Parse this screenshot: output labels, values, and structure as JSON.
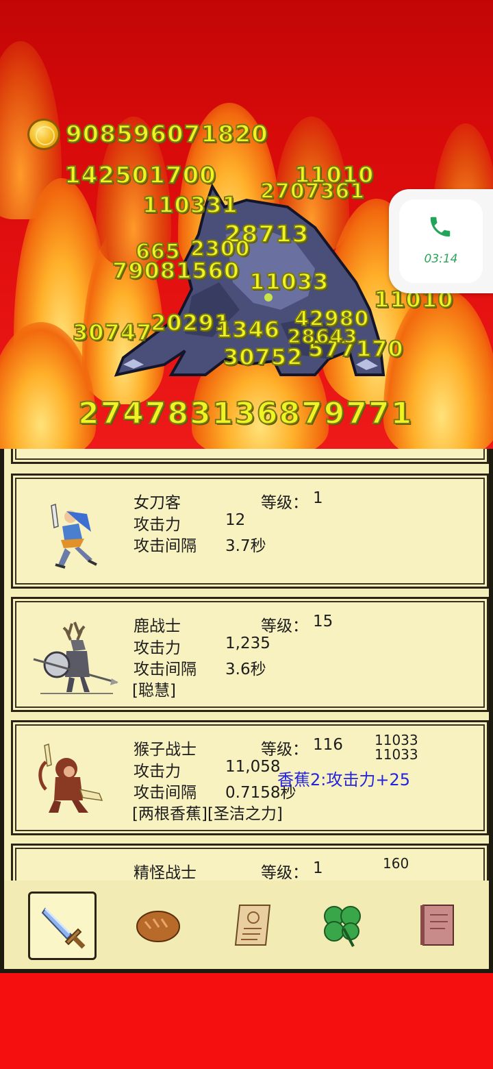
{
  "hud": {
    "gold": "908596071820",
    "boss_hp": "274783136879771"
  },
  "damage_numbers": [
    "142501700",
    "11010",
    "2707361",
    "110331",
    "28713",
    "665",
    "2300",
    "79081560",
    "11033",
    "11010",
    "30747",
    "20291",
    "1346",
    "42980",
    "30752",
    "577170",
    "28643"
  ],
  "call": {
    "time": "03:14"
  },
  "units": [
    {
      "name": "女刀客",
      "level_label": "等级：",
      "level": "1",
      "attack_label": "攻击力",
      "attack": "12",
      "interval_label": "攻击间隔",
      "interval": "3.7秒",
      "traits": ""
    },
    {
      "name": "鹿战士",
      "level_label": "等级：",
      "level": "15",
      "attack_label": "攻击力",
      "attack": "1,235",
      "interval_label": "攻击间隔",
      "interval": "3.6秒",
      "traits": "[聪慧]"
    },
    {
      "name": "猴子战士",
      "level_label": "等级：",
      "level": "116",
      "attack_label": "攻击力",
      "attack": "11,058",
      "interval_label": "攻击间隔",
      "interval": "0.7158秒",
      "traits": "[两根香蕉][圣洁之力]"
    },
    {
      "name": "精怪战士",
      "level_label": "等级：",
      "level": "1"
    }
  ],
  "card_floats": {
    "monkey_a": "11033",
    "monkey_b": "11033",
    "monkey_buff": "香蕉2:攻击力+25",
    "sprite_num": "160"
  },
  "tabs": [
    {
      "icon": "sword-icon",
      "active": true
    },
    {
      "icon": "bread-icon",
      "active": false
    },
    {
      "icon": "scroll-icon",
      "active": false
    },
    {
      "icon": "clover-icon",
      "active": false
    },
    {
      "icon": "book-icon",
      "active": false
    }
  ]
}
